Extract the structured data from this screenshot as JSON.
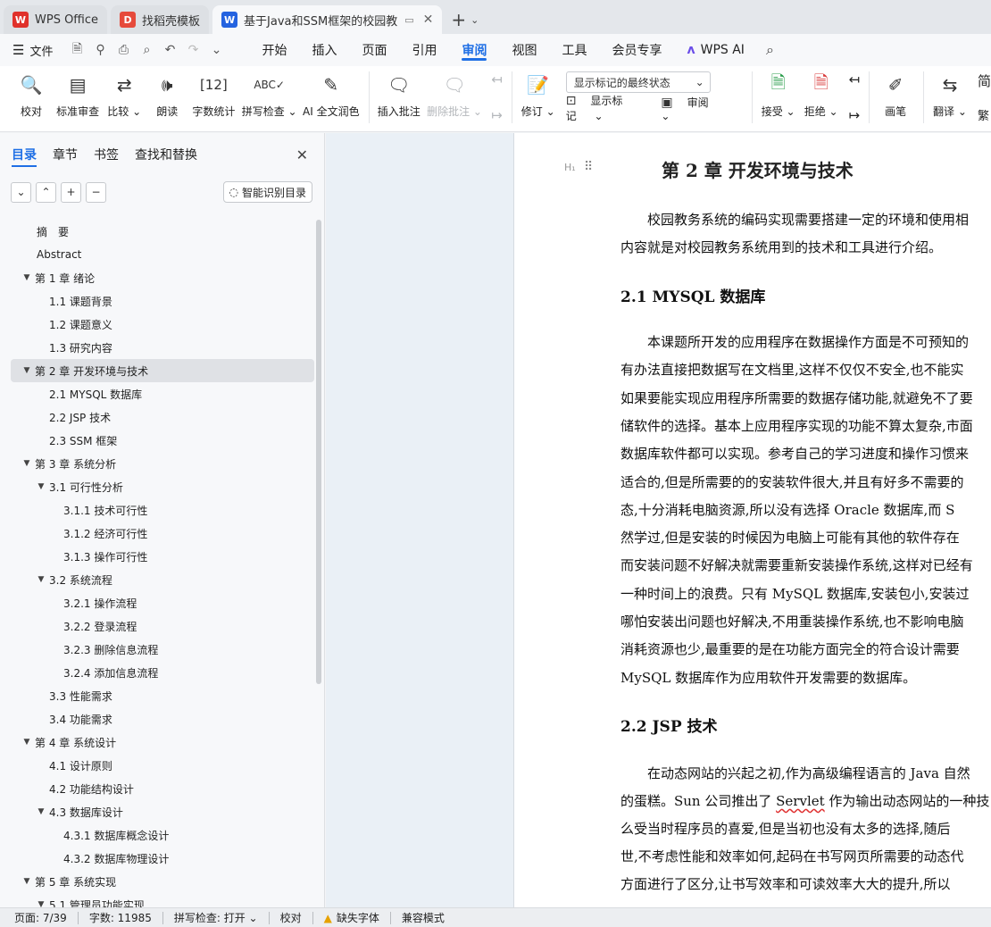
{
  "tabs": [
    {
      "label": "WPS Office",
      "logo": "W",
      "logo_color": "#e0312b"
    },
    {
      "label": "找稻壳模板",
      "logo": "D",
      "logo_color": "#e64a3b"
    },
    {
      "label": "基于Java和SSM框架的校园教",
      "logo": "W",
      "logo_color": "#2463e0"
    }
  ],
  "menubar": {
    "file": "文件",
    "tabs": [
      "开始",
      "插入",
      "页面",
      "引用",
      "审阅",
      "视图",
      "工具",
      "会员专享"
    ],
    "active": "审阅",
    "wps_ai": "WPS AI"
  },
  "ribbon": {
    "proofread": "校对",
    "std_review": "标准审查",
    "compare": "比较",
    "read_aloud": "朗读",
    "word_count": "字数统计",
    "spell_check": "拼写检查",
    "ai_polish": "AI 全文润色",
    "insert_comment": "插入批注",
    "delete_comment": "删除批注",
    "revise": "修订",
    "markup_select": "显示标记的最终状态",
    "show_markup": "显示标记",
    "review": "审阅",
    "accept": "接受",
    "reject": "拒绝",
    "draw": "画笔",
    "translate": "翻译",
    "trad": "繁",
    "simp": "简"
  },
  "sidebar": {
    "tabs": [
      "目录",
      "章节",
      "书签",
      "查找和替换"
    ],
    "smart_btn": "智能识别目录",
    "toc": [
      {
        "level": 0,
        "text": "摘　要",
        "arrow": ""
      },
      {
        "level": 0,
        "text": "Abstract",
        "arrow": ""
      },
      {
        "level": 0,
        "text": "第 1 章  绪论",
        "arrow": "▼"
      },
      {
        "level": 1,
        "text": "1.1  课题背景",
        "arrow": ""
      },
      {
        "level": 1,
        "text": "1.2  课题意义",
        "arrow": ""
      },
      {
        "level": 1,
        "text": "1.3  研究内容",
        "arrow": ""
      },
      {
        "level": 0,
        "text": "第 2 章  开发环境与技术",
        "arrow": "▼",
        "selected": true
      },
      {
        "level": 1,
        "text": "2.1 MYSQL 数据库",
        "arrow": ""
      },
      {
        "level": 1,
        "text": "2.2 JSP 技术",
        "arrow": ""
      },
      {
        "level": 1,
        "text": "2.3 SSM 框架",
        "arrow": ""
      },
      {
        "level": 0,
        "text": "第 3 章  系统分析",
        "arrow": "▼"
      },
      {
        "level": 1,
        "text": "3.1  可行性分析",
        "arrow": "▼"
      },
      {
        "level": 2,
        "text": "3.1.1  技术可行性",
        "arrow": ""
      },
      {
        "level": 2,
        "text": "3.1.2  经济可行性",
        "arrow": ""
      },
      {
        "level": 2,
        "text": "3.1.3  操作可行性",
        "arrow": ""
      },
      {
        "level": 1,
        "text": "3.2  系统流程",
        "arrow": "▼"
      },
      {
        "level": 2,
        "text": "3.2.1  操作流程",
        "arrow": ""
      },
      {
        "level": 2,
        "text": "3.2.2  登录流程",
        "arrow": ""
      },
      {
        "level": 2,
        "text": "3.2.3  删除信息流程",
        "arrow": ""
      },
      {
        "level": 2,
        "text": "3.2.4  添加信息流程",
        "arrow": ""
      },
      {
        "level": 1,
        "text": "3.3  性能需求",
        "arrow": ""
      },
      {
        "level": 1,
        "text": "3.4  功能需求",
        "arrow": ""
      },
      {
        "level": 0,
        "text": "第 4 章  系统设计",
        "arrow": "▼"
      },
      {
        "level": 1,
        "text": "4.1  设计原则",
        "arrow": ""
      },
      {
        "level": 1,
        "text": "4.2  功能结构设计",
        "arrow": ""
      },
      {
        "level": 1,
        "text": "4.3  数据库设计",
        "arrow": "▼"
      },
      {
        "level": 2,
        "text": "4.3.1  数据库概念设计",
        "arrow": ""
      },
      {
        "level": 2,
        "text": "4.3.2  数据库物理设计",
        "arrow": ""
      },
      {
        "level": 0,
        "text": "第 5 章  系统实现",
        "arrow": "▼"
      },
      {
        "level": 1,
        "text": "5.1  管理员功能实现",
        "arrow": "▼"
      }
    ]
  },
  "document": {
    "chapter_title": "第 2 章  开发环境与技术",
    "heading_marker": "H₁",
    "intro": [
      "　　校园教务系统的编码实现需要搭建一定的环境和使用相",
      "内容就是对校园教务系统用到的技术和工具进行介绍。"
    ],
    "h_mysql": "2.1 MYSQL 数据库",
    "mysql_para": [
      "　　本课题所开发的应用程序在数据操作方面是不可预知的",
      "有办法直接把数据写在文档里,这样不仅仅不安全,也不能实",
      "如果要能实现应用程序所需要的数据存储功能,就避免不了要",
      "储软件的选择。基本上应用程序实现的功能不算太复杂,市面",
      "数据库软件都可以实现。参考自己的学习进度和操作习惯来",
      "适合的,但是所需要的的安装软件很大,并且有好多不需要的",
      "态,十分消耗电脑资源,所以没有选择 Oracle 数据库,而 S",
      "然学过,但是安装的时候因为电脑上可能有其他的软件存在",
      "而安装问题不好解决就需要重新安装操作系统,这样对已经有",
      "一种时间上的浪费。只有 MySQL 数据库,安装包小,安装过",
      "哪怕安装出问题也好解决,不用重装操作系统,也不影响电脑",
      "消耗资源也少,最重要的是在功能方面完全的符合设计需要",
      "MySQL 数据库作为应用软件开发需要的数据库。"
    ],
    "h_jsp": "2.2 JSP 技术",
    "jsp_para_1": "　　在动态网站的兴起之初,作为高级编程语言的 Java 自然",
    "jsp_para_2_a": "的蛋糕。Sun 公司推出了 ",
    "jsp_para_2_b": "Servlet",
    "jsp_para_2_c": " 作为输出动态网站的一种技",
    "jsp_para_rest": [
      "么受当时程序员的喜爱,但是当初也没有太多的选择,随后",
      "世,不考虑性能和效率如何,起码在书写网页所需要的动态代",
      "方面进行了区分,让书写效率和可读效率大大的提升,所以"
    ]
  },
  "statusbar": {
    "page": "页面: 7/39",
    "words": "字数: 11985",
    "spell": "拼写检查: 打开",
    "proof": "校对",
    "missing_font": "缺失字体",
    "compat": "兼容模式"
  }
}
